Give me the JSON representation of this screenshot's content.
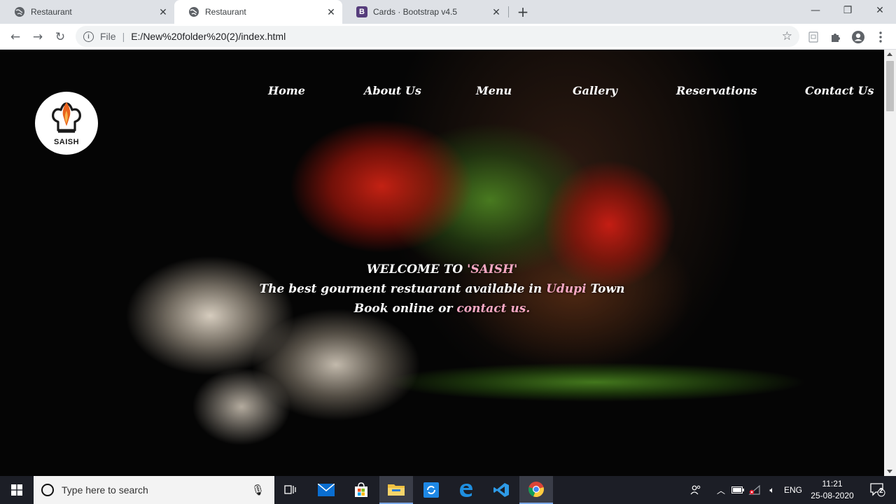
{
  "tabs": [
    {
      "title": "Restaurant",
      "favicon": "globe-icon"
    },
    {
      "title": "Restaurant",
      "favicon": "globe-icon",
      "active": true
    },
    {
      "title": "Cards · Bootstrap v4.5",
      "favicon": "bootstrap-icon",
      "favicon_letter": "B"
    }
  ],
  "address": {
    "scheme_label": "File",
    "url": "E:/New%20folder%20(2)/index.html"
  },
  "site": {
    "logo_text": "SAISH",
    "nav": [
      "Home",
      "About Us",
      "Menu",
      "Gallery",
      "Reservations",
      "Contact Us"
    ],
    "hero": {
      "welcome_prefix": "WELCOME TO ",
      "welcome_name": "'SAISH'",
      "tagline_prefix": "The best gourment restuarant available in ",
      "tagline_place": "Udupi",
      "tagline_suffix": " Town",
      "book_prefix": "Book online or ",
      "book_link": "contact us.",
      "accent_color": "#f7a8c3"
    }
  },
  "taskbar": {
    "search_placeholder": "Type here to search",
    "language": "ENG",
    "time": "11:21",
    "date": "25-08-2020",
    "notification_count": "2"
  }
}
